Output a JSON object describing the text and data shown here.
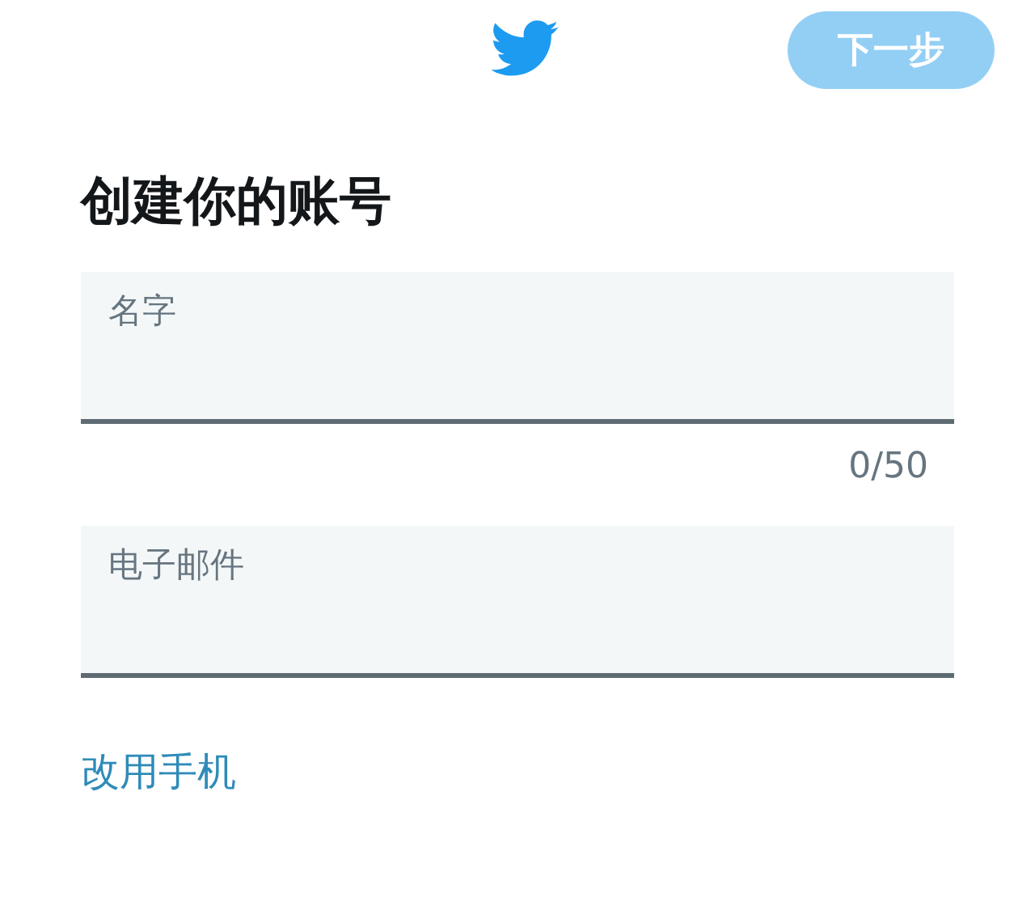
{
  "header": {
    "next_button": {
      "label": "下一步",
      "disabled": true
    }
  },
  "title": "创建你的账号",
  "fields": [
    {
      "placeholder": "名字",
      "counter": "0/50"
    },
    {
      "placeholder": "电子邮件"
    }
  ],
  "switch_link": "改用手机"
}
